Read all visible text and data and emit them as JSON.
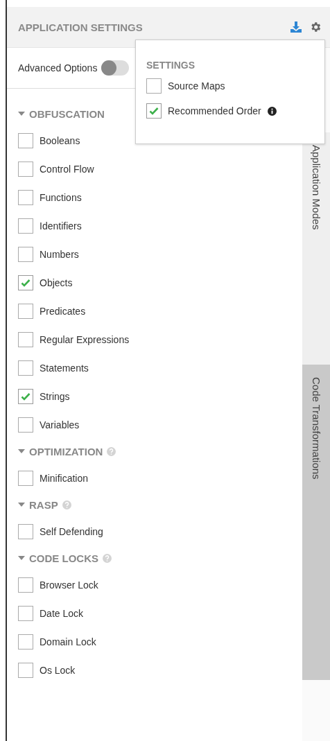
{
  "header": {
    "title": "APPLICATION SETTINGS"
  },
  "advanced_options": {
    "label": "Advanced Options",
    "on": false
  },
  "sections": [
    {
      "title": "OBFUSCATION",
      "expanded": true,
      "help": false,
      "items": [
        {
          "label": "Booleans",
          "checked": false
        },
        {
          "label": "Control Flow",
          "checked": false
        },
        {
          "label": "Functions",
          "checked": false
        },
        {
          "label": "Identifiers",
          "checked": false
        },
        {
          "label": "Numbers",
          "checked": false
        },
        {
          "label": "Objects",
          "checked": true
        },
        {
          "label": "Predicates",
          "checked": false
        },
        {
          "label": "Regular Expressions",
          "checked": false
        },
        {
          "label": "Statements",
          "checked": false
        },
        {
          "label": "Strings",
          "checked": true
        },
        {
          "label": "Variables",
          "checked": false
        }
      ]
    },
    {
      "title": "OPTIMIZATION",
      "expanded": true,
      "help": true,
      "items": [
        {
          "label": "Minification",
          "checked": false
        }
      ]
    },
    {
      "title": "RASP",
      "expanded": true,
      "help": true,
      "items": [
        {
          "label": "Self Defending",
          "checked": false
        }
      ]
    },
    {
      "title": "CODE LOCKS",
      "expanded": true,
      "help": true,
      "items": [
        {
          "label": "Browser Lock",
          "checked": false
        },
        {
          "label": "Date Lock",
          "checked": false
        },
        {
          "label": "Domain Lock",
          "checked": false
        },
        {
          "label": "Os Lock",
          "checked": false
        }
      ]
    }
  ],
  "side_tabs": [
    {
      "label": "Application Modes",
      "selected": false
    },
    {
      "label": "Code Transformations",
      "selected": true
    }
  ],
  "settings_popup": {
    "title": "SETTINGS",
    "items": [
      {
        "label": "Source Maps",
        "checked": false,
        "info": false
      },
      {
        "label": "Recommended Order",
        "checked": true,
        "info": true
      }
    ]
  }
}
